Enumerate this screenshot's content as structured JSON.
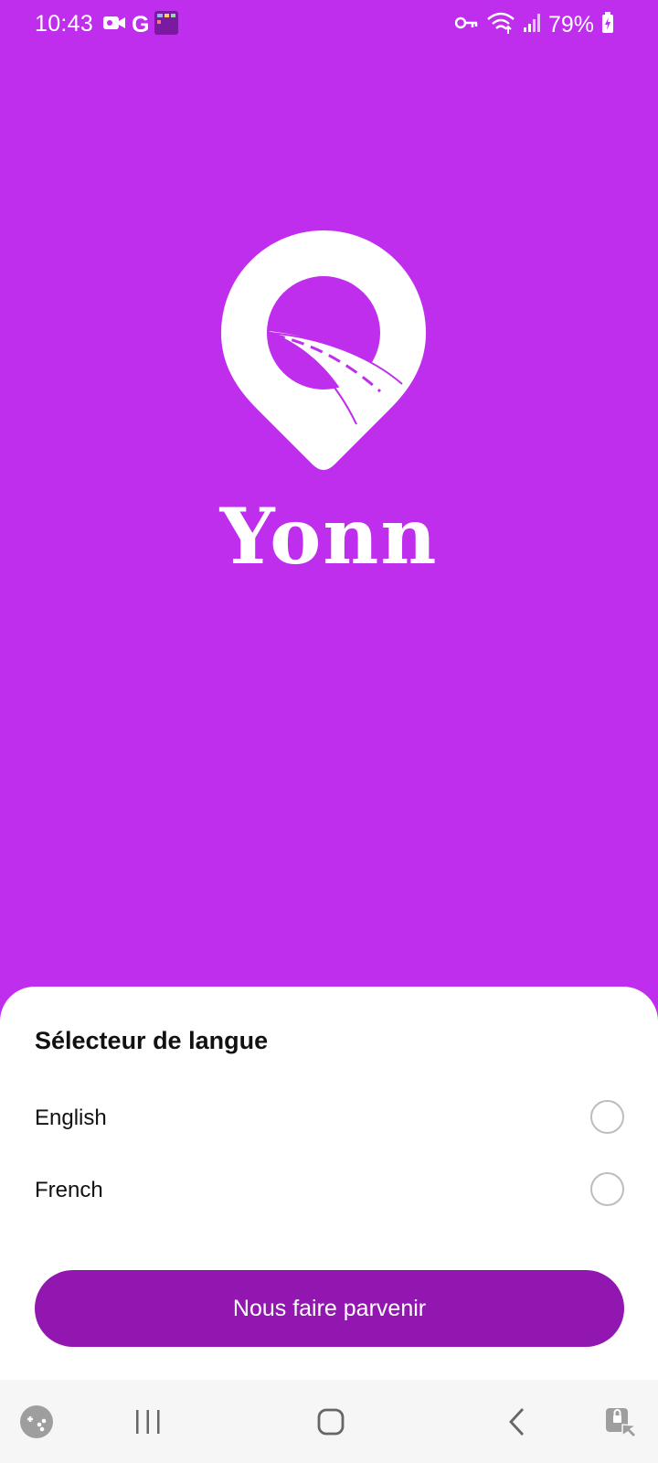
{
  "status_bar": {
    "time": "10:43",
    "battery": "79%",
    "left_icons": [
      "video-camera-icon",
      "google-icon",
      "app-thumbnail-icon"
    ],
    "right_icons": [
      "vpn-key-icon",
      "wifi-icon",
      "signal-icon",
      "battery-icon"
    ]
  },
  "splash": {
    "app_name": "Yonn",
    "logo": "map-pin-road-logo"
  },
  "language_sheet": {
    "title": "Sélecteur de langue",
    "options": [
      {
        "label": "English",
        "selected": false
      },
      {
        "label": "French",
        "selected": false
      }
    ],
    "submit_label": "Nous faire parvenir"
  },
  "nav_bar": {
    "items": [
      "game-launcher-icon",
      "recent-apps-icon",
      "home-icon",
      "back-icon",
      "accessibility-lock-icon"
    ]
  },
  "colors": {
    "background": "#bf2ded",
    "button": "#9117b0",
    "sheet": "#ffffff"
  }
}
